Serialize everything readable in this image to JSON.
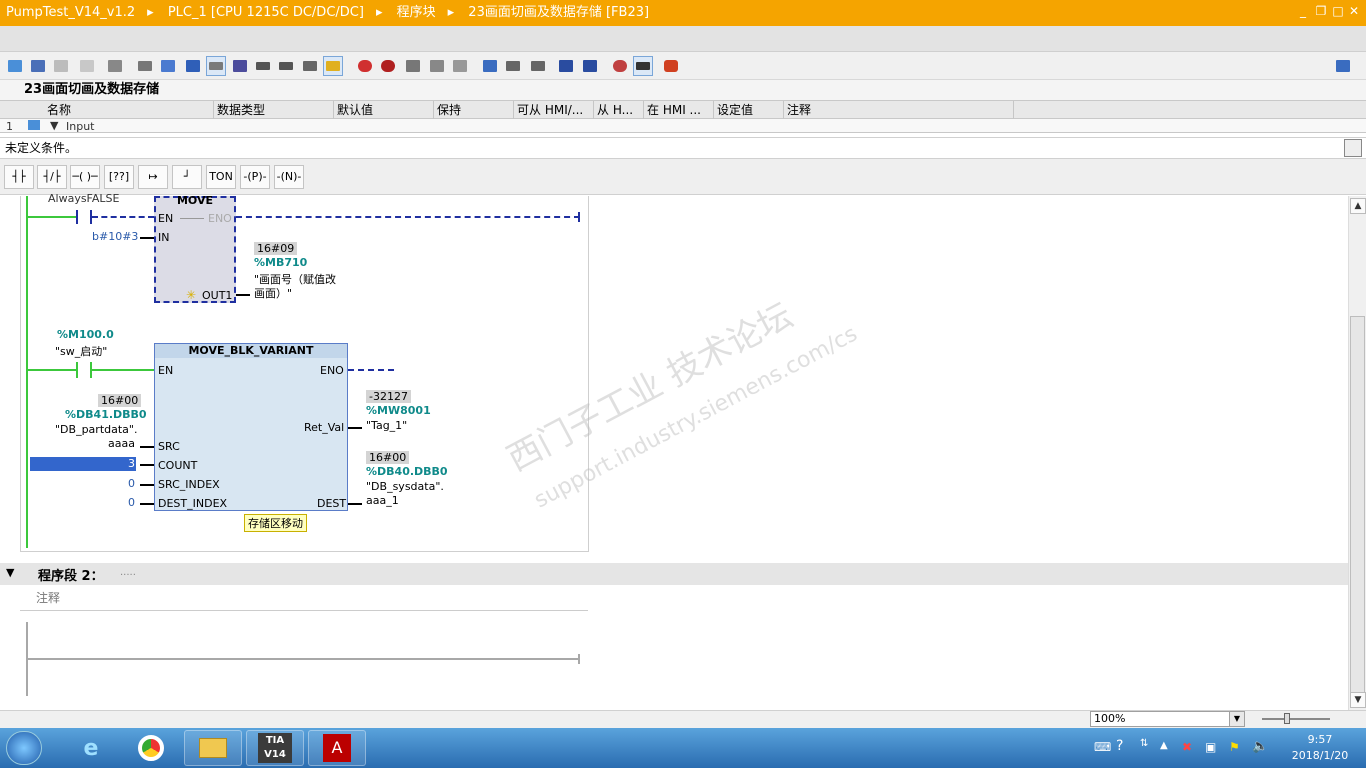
{
  "window": {
    "breadcrumb": [
      "PumpTest_V14_v1.2",
      "PLC_1 [CPU 1215C DC/DC/DC]",
      "程序块",
      "23画面切画及数据存储 [FB23]"
    ]
  },
  "interface": {
    "title": "23画面切画及数据存储",
    "columns": [
      "名称",
      "数据类型",
      "默认值",
      "保持",
      "可从 HMI/...",
      "从 H...",
      "在 HMI ...",
      "设定值",
      "注释"
    ],
    "first_row_num": "1",
    "first_row_name": "Input"
  },
  "condition_text": "未定义条件。",
  "ladder_tools": [
    "TON",
    "P",
    "N"
  ],
  "network1": {
    "contact_top_label": "AlwaysFALSE",
    "move": {
      "title": "MOVE",
      "en": "EN",
      "eno": "ENO",
      "in_pin": "IN",
      "in_value": "b#10#3",
      "out_pin": "OUT1",
      "out_value": "16#09",
      "out_addr": "%MB710",
      "out_tag_line1": "\"画面号（赋值改",
      "out_tag_line2": "画面）\""
    },
    "contact2_addr": "%M100.0",
    "contact2_tag": "\"sw_启动\"",
    "mbv": {
      "title": "MOVE_BLK_VARIANT",
      "en": "EN",
      "eno": "ENO",
      "src_value": "16#00",
      "src_addr": "%DB41.DBB0",
      "src_tag": "\"DB_partdata\".",
      "src_member": "aaaa",
      "src_pin": "SRC",
      "count_pin": "COUNT",
      "count_value": "3",
      "srcidx_pin": "SRC_INDEX",
      "srcidx_value": "0",
      "destidx_pin": "DEST_INDEX",
      "destidx_value": "0",
      "retval_pin": "Ret_Val",
      "retval_value": "-32127",
      "retval_addr": "%MW8001",
      "retval_tag": "\"Tag_1\"",
      "dest_pin": "DEST",
      "dest_value": "16#00",
      "dest_addr": "%DB40.DBB0",
      "dest_tag": "\"DB_sysdata\".",
      "dest_member": "aaa_1",
      "tooltip": "存储区移动"
    }
  },
  "network2": {
    "title": "程序段 2：",
    "dots": ".....",
    "comment": "注释"
  },
  "status": {
    "zoom": "100%"
  },
  "taskbar": {
    "tia_label": "TIA V14",
    "time": "9:57",
    "date": "2018/1/20"
  },
  "watermark": {
    "cn": "西门子工业 技术论坛",
    "url": "support.industry.siemens.com/cs"
  },
  "colors": {
    "titlebar": "#f5a400",
    "rail": "#3cc83c",
    "dashed_wire": "#1f2fa0",
    "teal_addr": "#0f8a8a",
    "selection": "#3366cc"
  }
}
